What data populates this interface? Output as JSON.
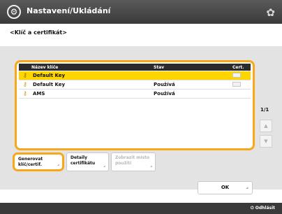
{
  "titlebar": {
    "icon": "settings-circle-icon",
    "title": "Nastavení/Ukládání"
  },
  "subheader": "<Klíč a certifikát>",
  "table": {
    "headers": [
      "Název klíče",
      "Stav",
      "Cert."
    ],
    "rows": [
      {
        "name": "Default Key",
        "use": "",
        "selected": true
      },
      {
        "name": "Default Key",
        "use": "Používá",
        "selected": false
      },
      {
        "name": "AMS",
        "use": "Používá",
        "selected": false
      }
    ]
  },
  "pager": "1/1",
  "buttons": {
    "generate": "Generovat klíč/certif.",
    "details": "Detaily certifikátu",
    "usage": "Zobrazit místo použití"
  },
  "ok": "OK",
  "logout": "Odhlásit"
}
